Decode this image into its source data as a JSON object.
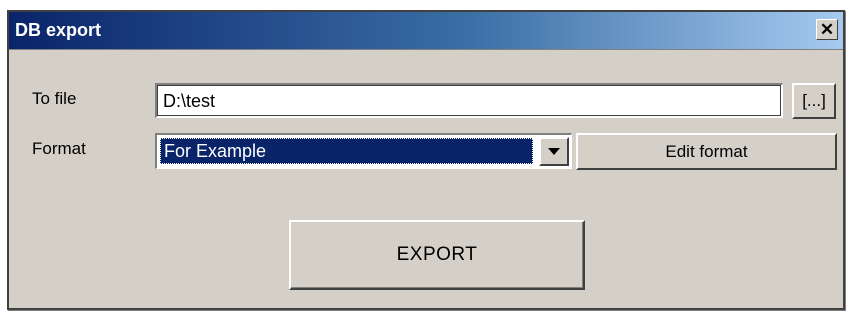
{
  "window": {
    "title": "DB export",
    "close_glyph": "✕"
  },
  "form": {
    "file_label": "To file",
    "file_value": "D:\\test",
    "browse_label": "[...]",
    "format_label": "Format",
    "format_selected": "For Example",
    "edit_format_label": "Edit format",
    "export_label": "EXPORT"
  },
  "icons": {
    "close": "close-icon",
    "dropdown": "chevron-down-icon"
  },
  "colors": {
    "titlebar_start": "#0a246a",
    "titlebar_end": "#a6caf0",
    "face": "#d4d0c8",
    "selection": "#0a246a"
  }
}
